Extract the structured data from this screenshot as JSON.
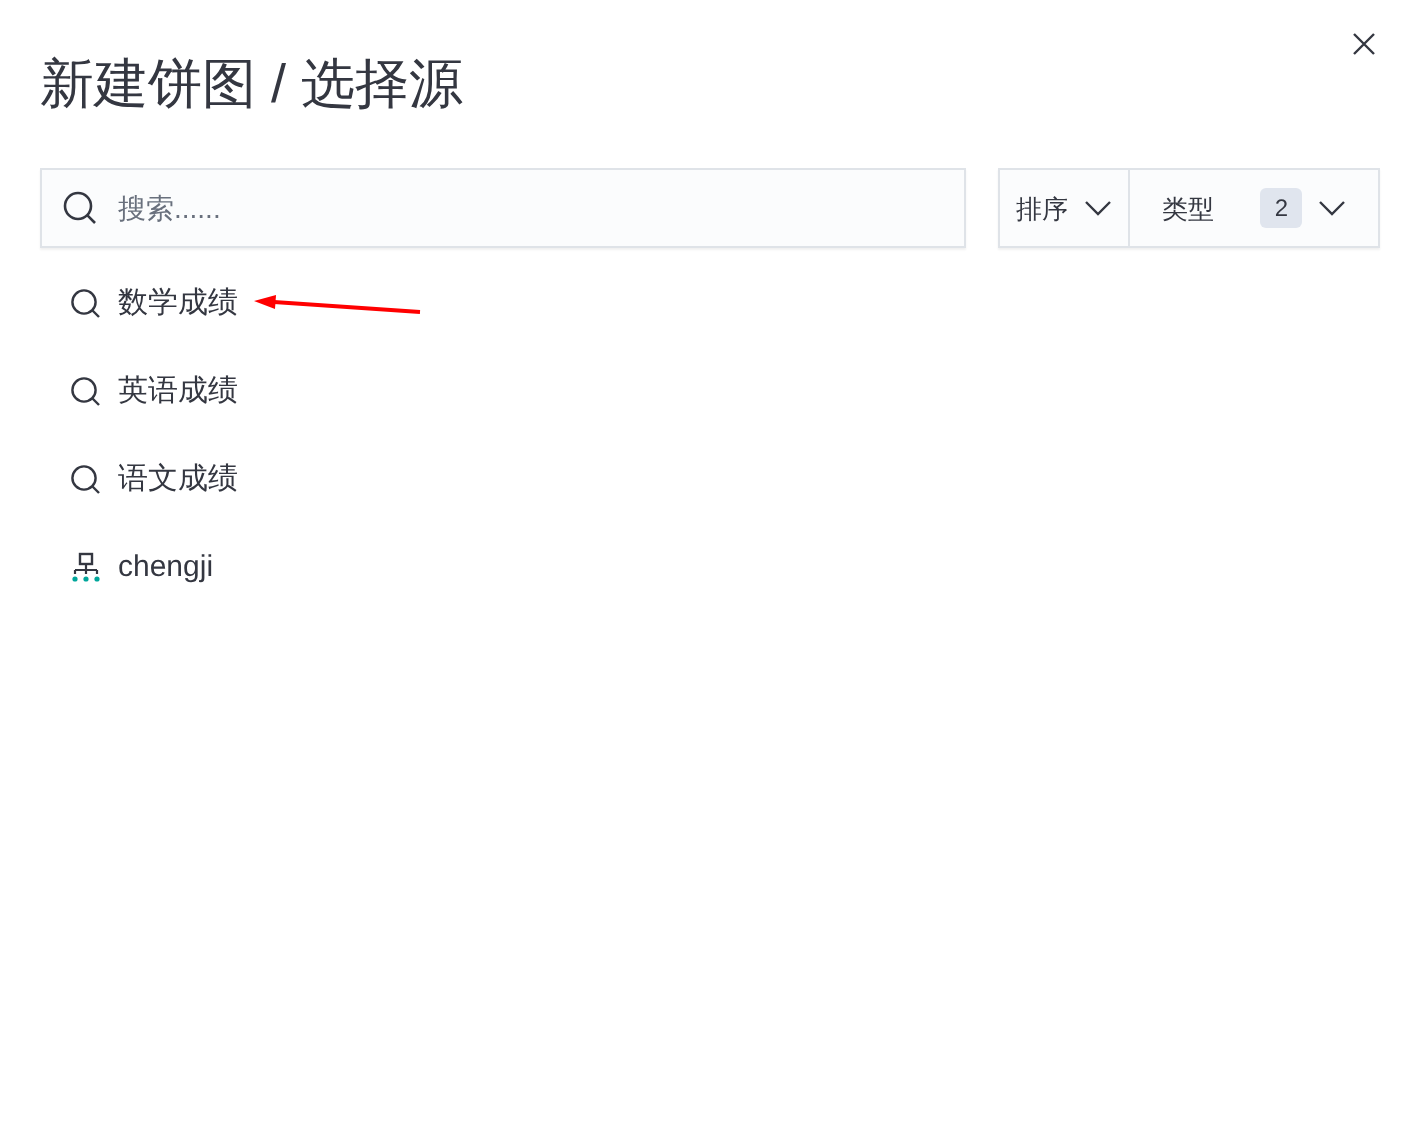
{
  "title": "新建饼图 / 选择源",
  "search": {
    "placeholder": "搜索......"
  },
  "sort": {
    "label": "排序"
  },
  "type_filter": {
    "label": "类型",
    "count": "2"
  },
  "items": [
    {
      "label": "数学成绩",
      "kind": "search",
      "annotated": true
    },
    {
      "label": "英语成绩",
      "kind": "search",
      "annotated": false
    },
    {
      "label": "语文成绩",
      "kind": "search",
      "annotated": false
    },
    {
      "label": "chengji",
      "kind": "index",
      "annotated": false
    }
  ]
}
